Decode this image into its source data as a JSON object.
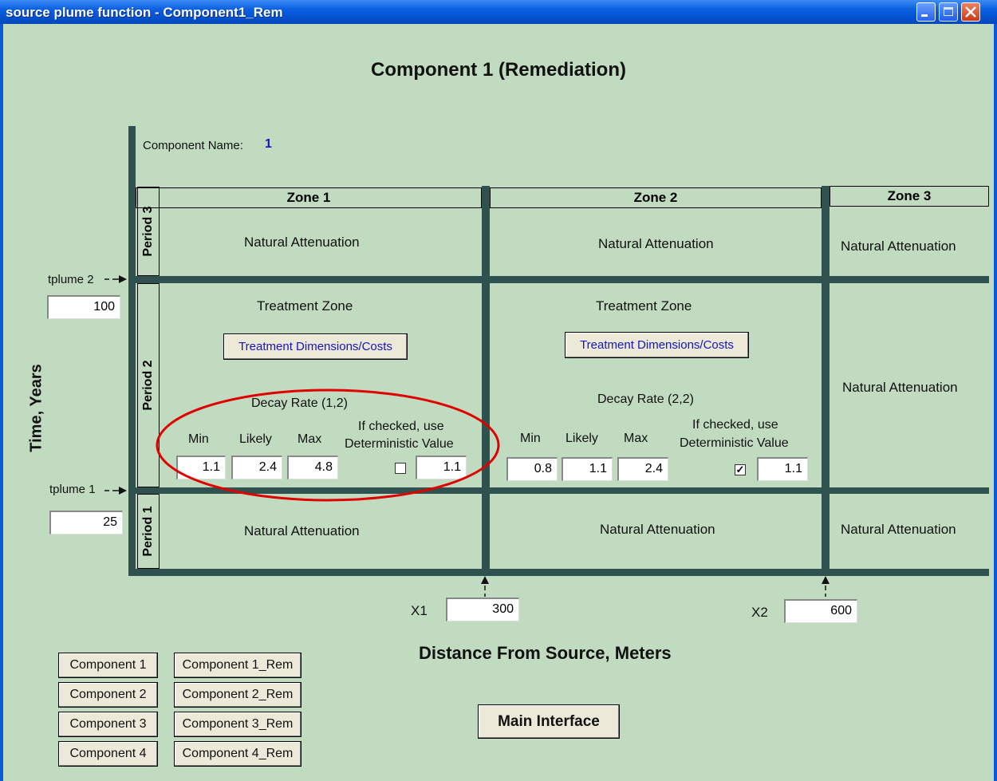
{
  "window": {
    "title": "source plume  function - Component1_Rem"
  },
  "heading": "Component 1 (Remediation)",
  "component_name": {
    "label": "Component Name:",
    "value": "1"
  },
  "axes": {
    "y_label": "Time, Years",
    "x_label": "Distance From Source, Meters"
  },
  "zones": [
    "Zone 1",
    "Zone 2",
    "Zone 3"
  ],
  "periods": [
    "Period 3",
    "Period 2",
    "Period 1"
  ],
  "time_inputs": {
    "tplume2": {
      "label": "tplume 2",
      "value": "100"
    },
    "tplume1": {
      "label": "tplume 1",
      "value": "25"
    }
  },
  "distance_inputs": {
    "x1": {
      "label": "X1",
      "value": "300"
    },
    "x2": {
      "label": "X2",
      "value": "600"
    }
  },
  "cells": {
    "natural_attenuation": "Natural Attenuation",
    "treatment_zone": "Treatment Zone",
    "treatment_button": "Treatment Dimensions/Costs"
  },
  "decay_zone1": {
    "title": "Decay Rate (1,2)",
    "min_label": "Min",
    "likely_label": "Likely",
    "max_label": "Max",
    "det_label_1": "If checked, use",
    "det_label_2": "Deterministic Value",
    "min": "1.1",
    "likely": "2.4",
    "max": "4.8",
    "deterministic": "1.1",
    "checked": false
  },
  "decay_zone2": {
    "title": "Decay Rate (2,2)",
    "min_label": "Min",
    "likely_label": "Likely",
    "max_label": "Max",
    "det_label_1": "If checked, use",
    "det_label_2": "Deterministic Value",
    "min": "0.8",
    "likely": "1.1",
    "max": "2.4",
    "deterministic": "1.1",
    "checked": true
  },
  "nav_buttons": {
    "c1": "Component 1",
    "c2": "Component 2",
    "c3": "Component 3",
    "c4": "Component 4",
    "r1": "Component 1_Rem",
    "r2": "Component 2_Rem",
    "r3": "Component 3_Rem",
    "r4": "Component 4_Rem"
  },
  "main_interface": "Main Interface",
  "check_mark": "✓",
  "colors": {
    "background": "#c1dbc1",
    "grid": "#2f5250",
    "highlight": "#e00000",
    "link_text": "#1414c8"
  }
}
